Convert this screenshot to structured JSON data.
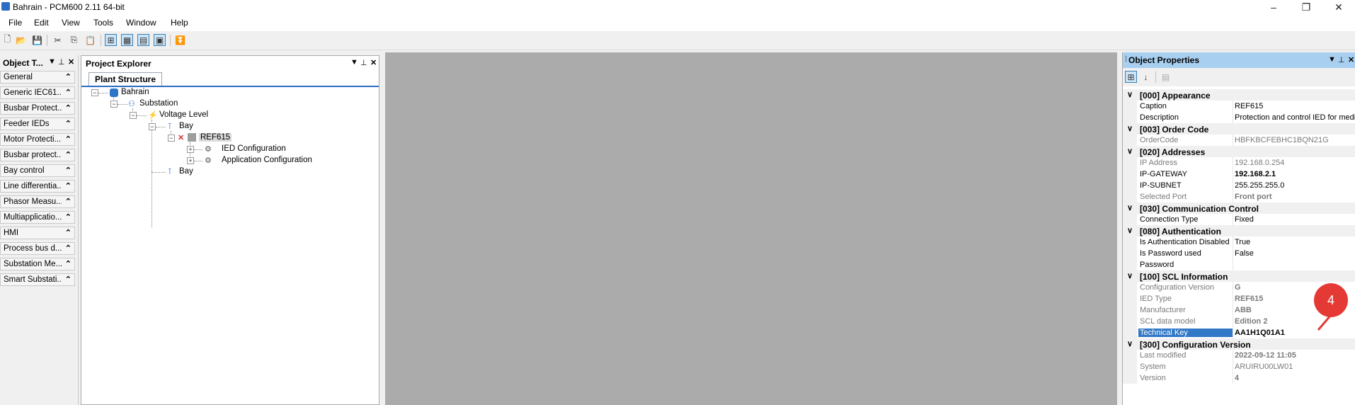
{
  "window": {
    "title": "Bahrain - PCM600 2.11 64-bit",
    "controls": [
      "–",
      "❐",
      "✕"
    ]
  },
  "menu": [
    "File",
    "Edit",
    "View",
    "Tools",
    "Window",
    "Help"
  ],
  "object_types": {
    "title": "Object T...",
    "items": [
      "General",
      "Generic IEC61...",
      "Busbar Protect...",
      "Feeder IEDs",
      "Motor Protecti...",
      "Busbar protect...",
      "Bay control",
      "Line differentia...",
      "Phasor Measu...",
      "Multiapplicatio...",
      "HMI",
      "Process bus d...",
      "Substation Me...",
      "Smart Substati..."
    ]
  },
  "project_explorer": {
    "title": "Project Explorer",
    "tab": "Plant Structure",
    "tree": {
      "root": "Bahrain",
      "substation": "Substation",
      "voltage_level": "Voltage Level",
      "bay1": "Bay",
      "ied": "REF615",
      "ied_config": "IED Configuration",
      "app_config": "Application Configuration",
      "bay2": "Bay"
    }
  },
  "object_properties": {
    "title": "Object Properties",
    "categories": {
      "appearance": "[000] Appearance",
      "order_code": "[003] Order Code",
      "addresses": "[020] Addresses",
      "comm": "[030] Communication Control",
      "auth": "[080] Authentication",
      "scl": "[100] SCL Information",
      "config": "[300] Configuration Version"
    },
    "rows": {
      "caption": {
        "k": "Caption",
        "v": "REF615"
      },
      "description": {
        "k": "Description",
        "v": "Protection and control IED for mediu"
      },
      "ordercode": {
        "k": "OrderCode",
        "v": "HBFKBCFEBHC1BQN21G"
      },
      "ip": {
        "k": "IP Address",
        "v": "192.168.0.254"
      },
      "gateway": {
        "k": "IP-GATEWAY",
        "v": "192.168.2.1"
      },
      "subnet": {
        "k": "IP-SUBNET",
        "v": "255.255.255.0"
      },
      "port": {
        "k": "Selected Port",
        "v": "Front port"
      },
      "conntype": {
        "k": "Connection Type",
        "v": "Fixed"
      },
      "authdis": {
        "k": "Is Authentication Disabled",
        "v": "True"
      },
      "pwused": {
        "k": "Is Password used",
        "v": "False"
      },
      "password": {
        "k": "Password",
        "v": ""
      },
      "confver": {
        "k": "Configuration Version",
        "v": "G"
      },
      "iedtype": {
        "k": "IED Type",
        "v": "REF615"
      },
      "manufacturer": {
        "k": "Manufacturer",
        "v": "ABB"
      },
      "scldm": {
        "k": "SCL data model",
        "v": "Edition 2"
      },
      "techkey": {
        "k": "Technical Key",
        "v": "AA1H1Q01A1"
      },
      "lastmod": {
        "k": "Last modified",
        "v": "2022-09-12 11:05"
      },
      "system": {
        "k": "System",
        "v": "ARUIRU00LW01"
      },
      "version": {
        "k": "Version",
        "v": "4"
      }
    }
  },
  "callout": "4"
}
